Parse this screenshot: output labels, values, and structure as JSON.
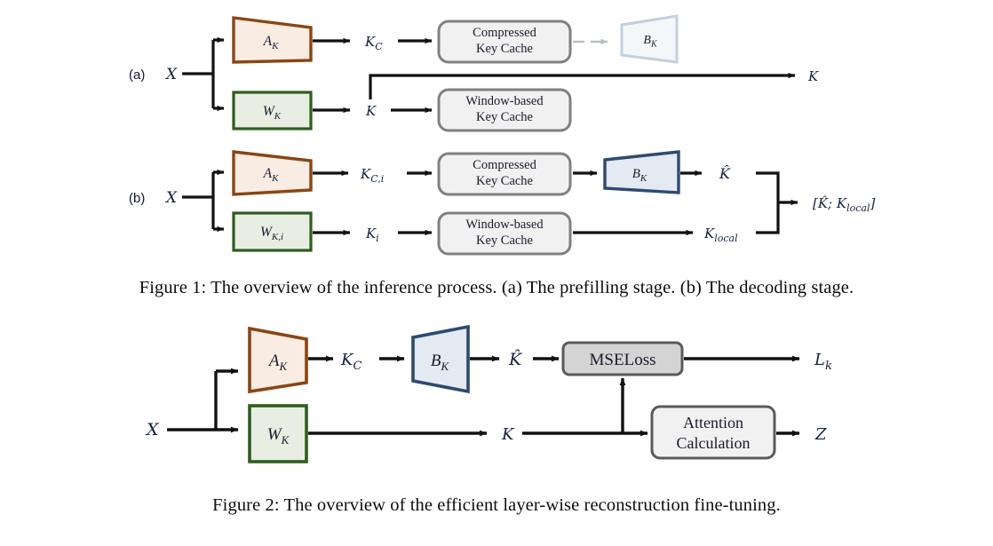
{
  "document": {
    "type": "academic-figure-page",
    "background_color": "#ffffff"
  },
  "figure1": {
    "id": "figure-1",
    "caption": "Figure 1: The overview of the inference process. (a) The prefilling stage. (b) The decoding stage.",
    "panels": [
      {
        "panel_label": "(a)",
        "name": "prefilling-stage",
        "input_label": "X",
        "blocks": [
          {
            "name": "a-k-projection",
            "label": "A",
            "sub": "K",
            "shape": "trapezoid-narrowing",
            "border_color": "#8a4513",
            "fill_color": "#f8ece3",
            "faded": false
          },
          {
            "name": "w-k-projection",
            "label": "W",
            "sub": "K",
            "shape": "rectangle",
            "border_color": "#2f5d1f",
            "fill_color": "#e9eee3",
            "faded": false
          },
          {
            "name": "b-k-projection-disabled",
            "label": "B",
            "sub": "K",
            "shape": "trapezoid-widening",
            "border_color": "#c3cfdc",
            "fill_color": "#f4f7fa",
            "faded": true
          }
        ],
        "caches": [
          {
            "name": "compressed-key-cache",
            "line1": "Compressed",
            "line2": "Key Cache",
            "border_color": "#808080",
            "fill_color": "#f1f1f1"
          },
          {
            "name": "window-based-key-cache",
            "line1": "Window-based",
            "line2": "Key Cache",
            "border_color": "#808080",
            "fill_color": "#f1f1f1"
          }
        ],
        "signals": {
          "compressed_key": "K",
          "compressed_key_sub": "C",
          "window_key": "K",
          "output_key": "K"
        }
      },
      {
        "panel_label": "(b)",
        "name": "decoding-stage",
        "input_label": "X",
        "blocks": [
          {
            "name": "a-k-projection",
            "label": "A",
            "sub": "K",
            "shape": "trapezoid-narrowing",
            "border_color": "#8a4513",
            "fill_color": "#f8ece3",
            "faded": false
          },
          {
            "name": "w-k-i-projection",
            "label": "W",
            "sub": "K,i",
            "shape": "rectangle",
            "border_color": "#2f5d1f",
            "fill_color": "#e9eee3",
            "faded": false
          },
          {
            "name": "b-k-projection",
            "label": "B",
            "sub": "K",
            "shape": "trapezoid-narrowing",
            "border_color": "#2e4a72",
            "fill_color": "#e3eaf1",
            "faded": false
          }
        ],
        "caches": [
          {
            "name": "compressed-key-cache",
            "line1": "Compressed",
            "line2": "Key Cache",
            "border_color": "#808080",
            "fill_color": "#f1f1f1"
          },
          {
            "name": "window-based-key-cache",
            "line1": "Window-based",
            "line2": "Key Cache",
            "border_color": "#808080",
            "fill_color": "#f1f1f1"
          }
        ],
        "signals": {
          "compressed_key": "K",
          "compressed_key_sub": "C,i",
          "window_key": "K",
          "window_key_sub": "i",
          "reconstructed_key": "K̂",
          "local_key": "K",
          "local_key_sub": "local",
          "concat_output": "[K̂; K",
          "concat_output_sub": "local",
          "concat_output_tail": "]"
        }
      }
    ]
  },
  "figure2": {
    "id": "figure-2",
    "caption": "Figure 2: The overview of the efficient layer-wise reconstruction fine-tuning.",
    "name": "layer-wise-reconstruction-finetuning",
    "input_label": "X",
    "blocks": [
      {
        "name": "a-k-projection",
        "label": "A",
        "sub": "K",
        "shape": "trapezoid-narrowing",
        "border_color": "#8a4513",
        "fill_color": "#f8ece3"
      },
      {
        "name": "w-k-projection",
        "label": "W",
        "sub": "K",
        "shape": "rectangle",
        "border_color": "#2f5d1f",
        "fill_color": "#e9eee3"
      },
      {
        "name": "b-k-projection",
        "label": "B",
        "sub": "K",
        "shape": "trapezoid-widening",
        "border_color": "#2e4a72",
        "fill_color": "#e3eaf1"
      }
    ],
    "operations": [
      {
        "name": "mse-loss-block",
        "label": "MSELoss",
        "border_color": "#5a5a5a",
        "fill_color": "#d4d4d4"
      },
      {
        "name": "attention-calculation-block",
        "line1": "Attention",
        "line2": "Calculation",
        "border_color": "#5a5a5a",
        "fill_color": "#f1f1f1"
      }
    ],
    "signals": {
      "compressed_key": "K",
      "compressed_key_sub": "C",
      "reconstructed_key": "K̂",
      "key": "K",
      "loss_output": "L",
      "loss_output_sub": "k",
      "attention_output": "Z"
    }
  },
  "colors": {
    "arrow": "#111111",
    "faded_arrow": "#b9bfc6",
    "text": "#16213e",
    "caption": "#0d0d0d"
  }
}
